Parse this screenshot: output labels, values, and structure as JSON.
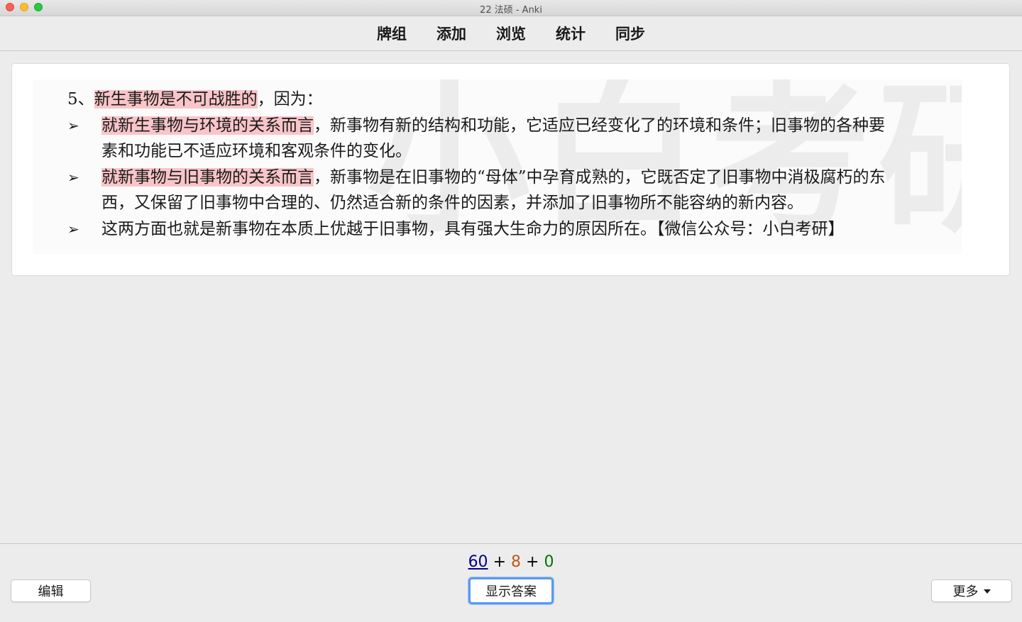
{
  "window": {
    "title": "22 法硕 - Anki"
  },
  "toolbar": {
    "items": [
      "牌组",
      "添加",
      "浏览",
      "统计",
      "同步"
    ]
  },
  "card": {
    "watermark": "小白考研",
    "heading_prefix": "5、",
    "heading_highlight": "新生事物是不可战胜的",
    "heading_suffix": "，因为：",
    "bullet_symbol": "➢",
    "bullets": [
      {
        "highlight": "就新生事物与环境的关系而言",
        "line1_rest": "，新事物有新的结构和功能，它适应已经变化了的环境和条件；旧事物的各种要",
        "line2": "素和功能已不适应环境和客观条件的变化。"
      },
      {
        "highlight": "就新事物与旧事物的关系而言",
        "line1_rest": "，新事物是在旧事物的“母体”中孕育成熟的，它既否定了旧事物中消极腐朽的东",
        "line2": "西，又保留了旧事物中合理的、仍然适合新的条件的因素，并添加了旧事物所不能容纳的新内容。"
      },
      {
        "text": "这两方面也就是新事物在本质上优越于旧事物，具有强大生命力的原因所在。【微信公众号：小白考研】"
      }
    ]
  },
  "bottom": {
    "count_new": "60",
    "count_learn": "8",
    "count_review": "0",
    "plus": "+",
    "edit_label": "编辑",
    "show_answer_label": "显示答案",
    "more_label": "更多"
  },
  "colors": {
    "highlight": "#f9c5c8",
    "count_new": "#00008b",
    "count_learn": "#c35617",
    "count_review": "#007700",
    "focus_ring": "#5b9bf0"
  }
}
